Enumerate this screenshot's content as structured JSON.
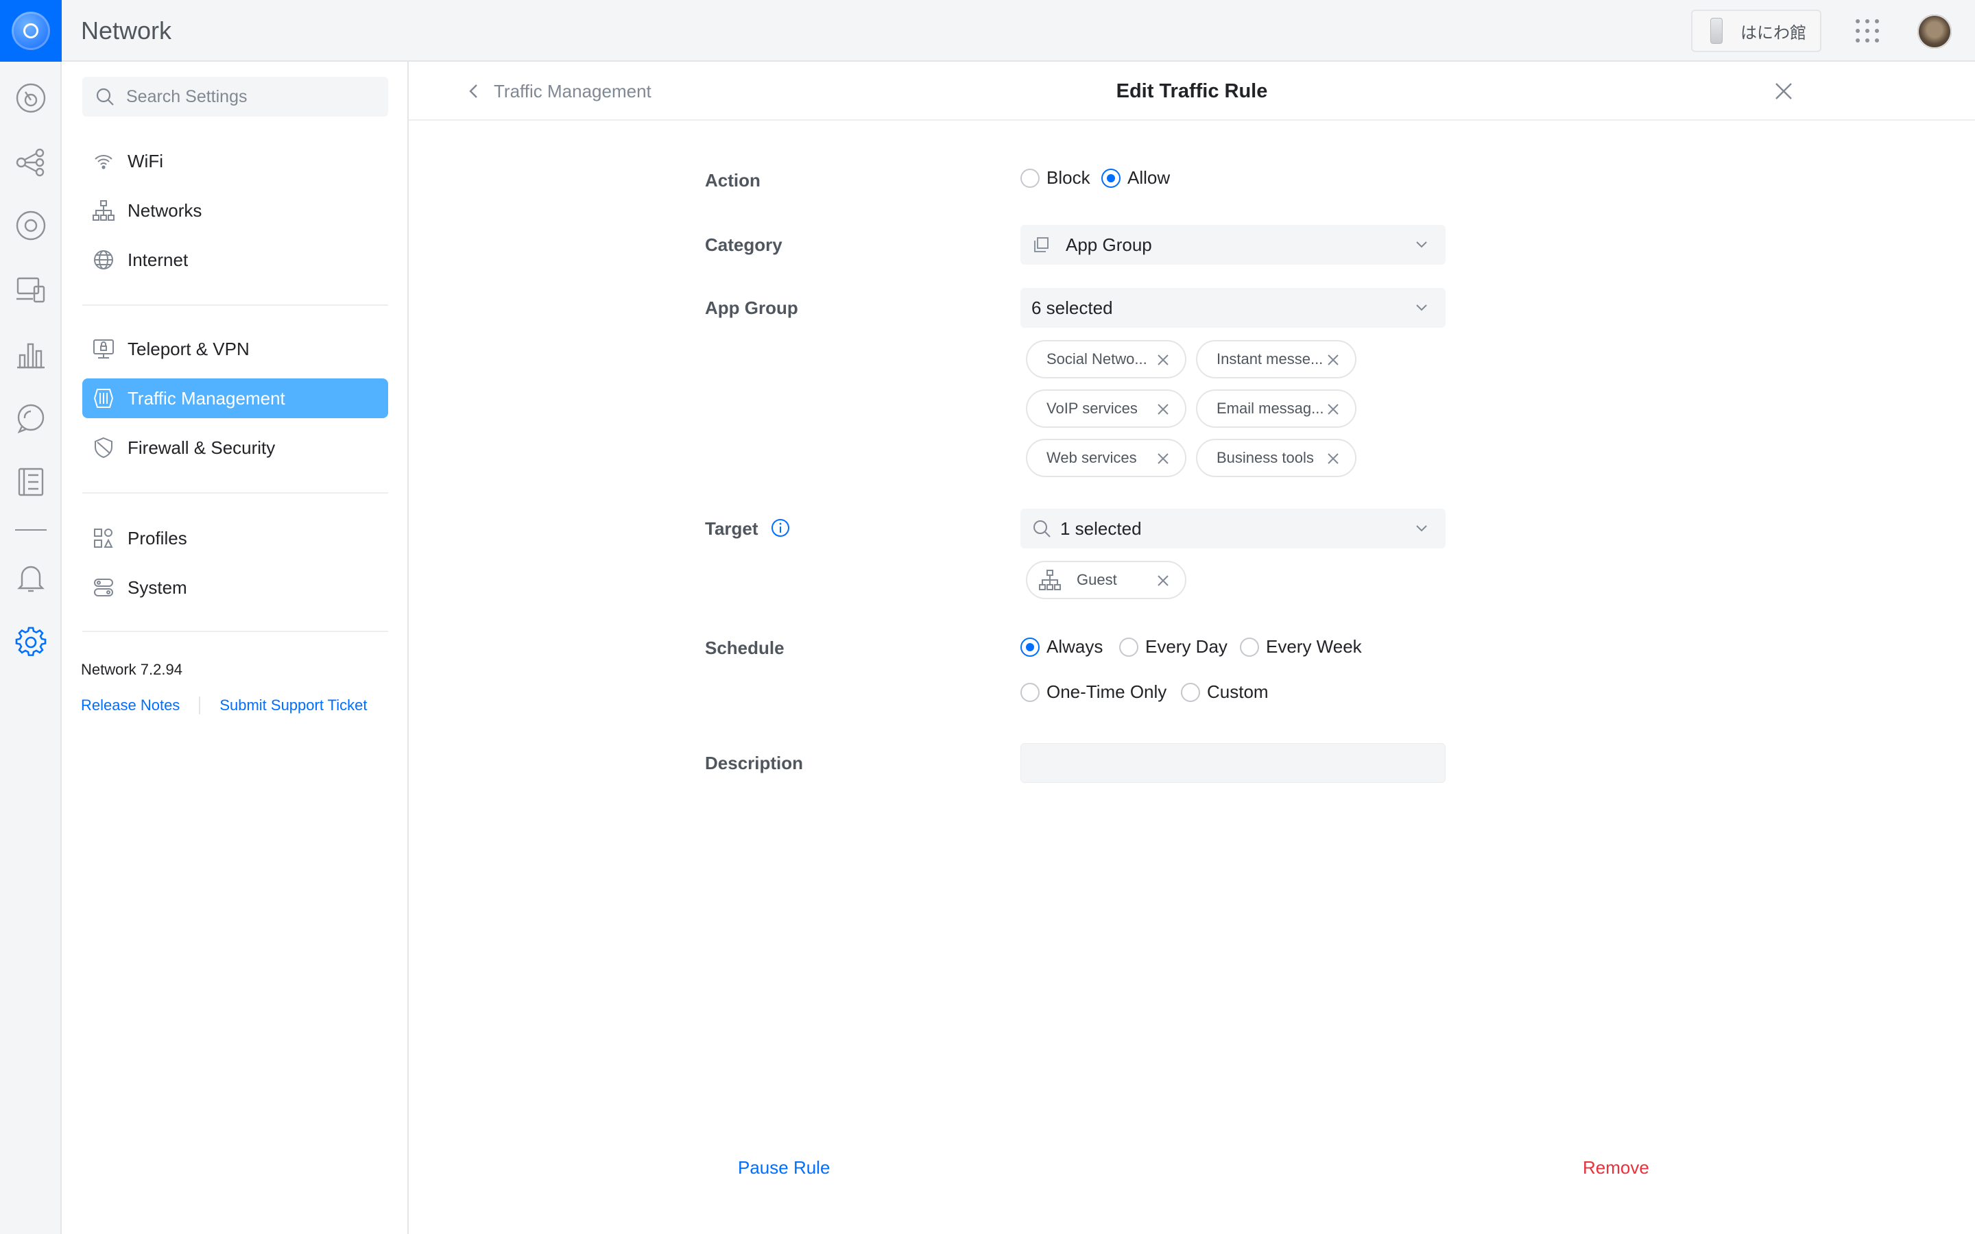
{
  "app": {
    "title": "Network",
    "device_name": "はにわ館"
  },
  "rail": {
    "icons": [
      "dashboard-icon",
      "topology-icon",
      "devices-icon",
      "clients-icon",
      "statistics-icon",
      "insights-icon",
      "logs-icon",
      "notifications-icon",
      "settings-icon"
    ]
  },
  "sidebar": {
    "search_placeholder": "Search Settings",
    "items": [
      {
        "label": "WiFi",
        "icon": "wifi-icon"
      },
      {
        "label": "Networks",
        "icon": "networks-icon"
      },
      {
        "label": "Internet",
        "icon": "globe-icon"
      },
      {
        "label": "Teleport & VPN",
        "icon": "vpn-icon"
      },
      {
        "label": "Traffic Management",
        "icon": "traffic-icon"
      },
      {
        "label": "Firewall & Security",
        "icon": "shield-icon"
      },
      {
        "label": "Profiles",
        "icon": "profiles-icon"
      },
      {
        "label": "System",
        "icon": "system-icon"
      }
    ],
    "active_item": "Traffic Management",
    "version": "Network 7.2.94",
    "release_notes": "Release Notes",
    "support_ticket": "Submit Support Ticket"
  },
  "panel": {
    "back_label": "Traffic Management",
    "title": "Edit Traffic Rule",
    "action": {
      "label": "Action",
      "options": [
        "Block",
        "Allow"
      ],
      "selected": "Allow"
    },
    "category": {
      "label": "Category",
      "value": "App Group"
    },
    "app_group": {
      "label": "App Group",
      "value": "6 selected",
      "chips": [
        "Social Netwo...",
        "Instant messe...",
        "VoIP services",
        "Email messag...",
        "Web services",
        "Business tools"
      ]
    },
    "target": {
      "label": "Target",
      "value": "1 selected",
      "chips": [
        "Guest"
      ]
    },
    "schedule": {
      "label": "Schedule",
      "options": [
        "Always",
        "Every Day",
        "Every Week",
        "One-Time Only",
        "Custom"
      ],
      "selected": "Always"
    },
    "description": {
      "label": "Description",
      "value": ""
    },
    "pause_label": "Pause Rule",
    "remove_label": "Remove"
  },
  "colors": {
    "accent": "#006fff",
    "active_nav": "#52b2ff",
    "danger": "#e8313b",
    "field_bg": "#f4f5f6"
  }
}
